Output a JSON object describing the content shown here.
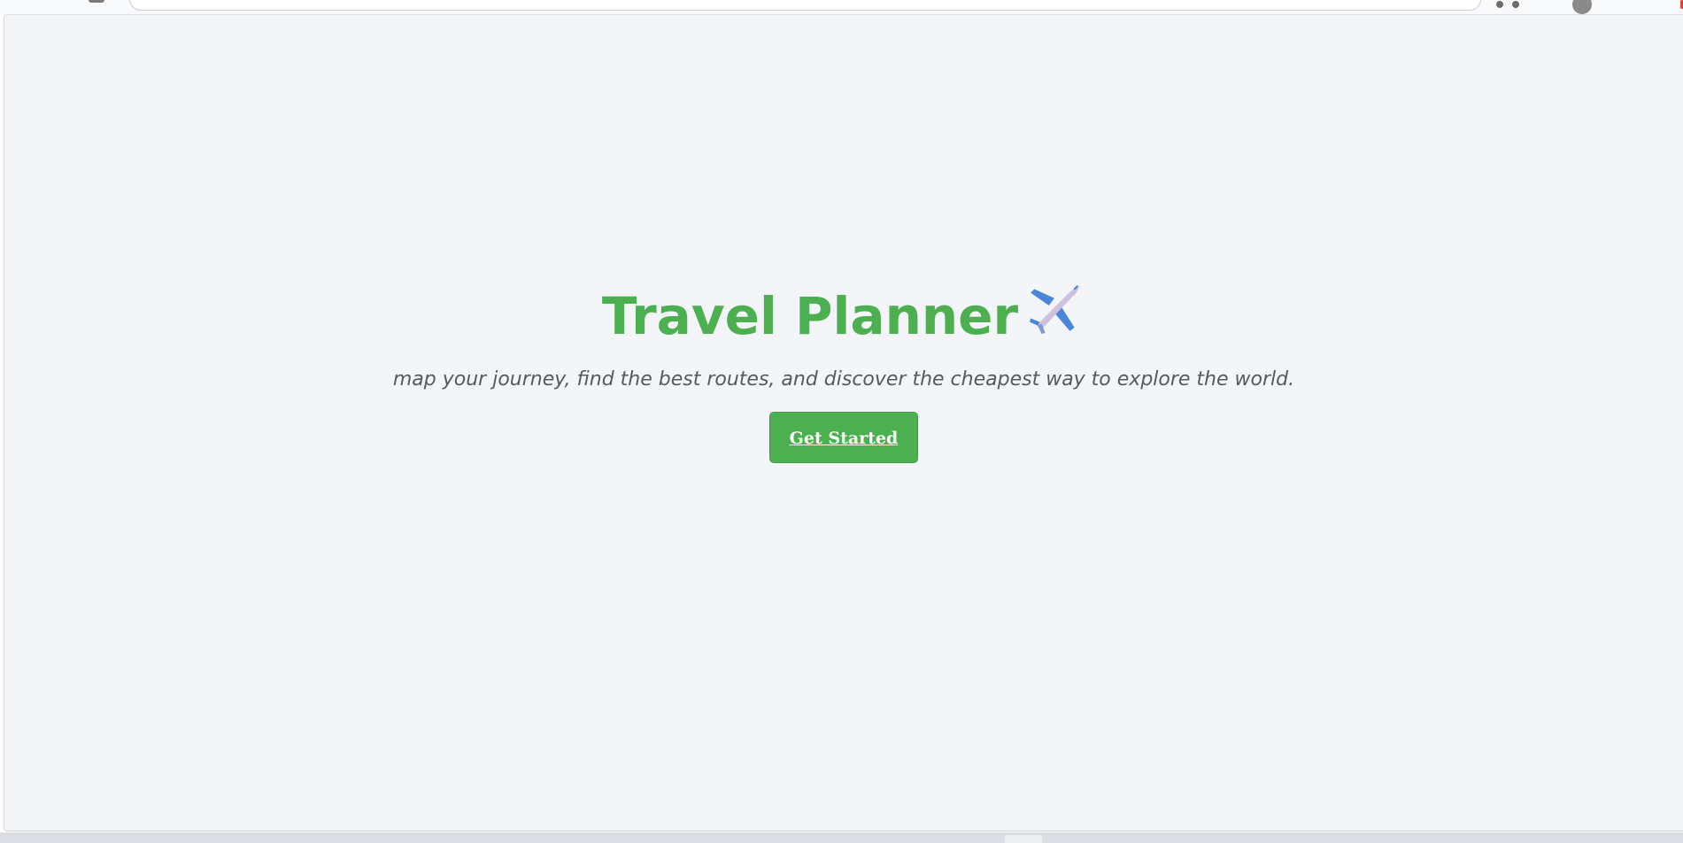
{
  "hero": {
    "title": "Travel Planner",
    "title_icon": "airplane-icon",
    "subtitle": "map your journey, find the best routes, and discover the cheapest way to explore the world.",
    "cta_label": "Get Started"
  },
  "colors": {
    "accent": "#4cb050",
    "subtitle_text": "#555a60",
    "page_background": "#f4f5f9"
  }
}
